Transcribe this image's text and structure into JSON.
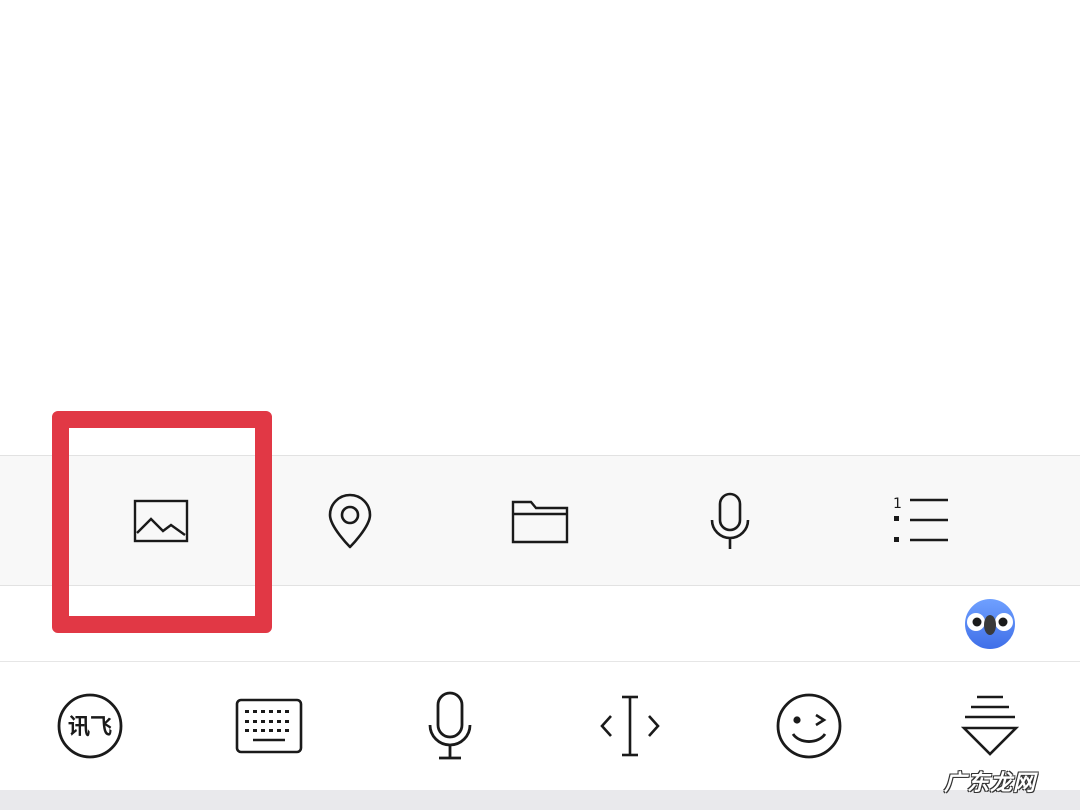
{
  "attach_toolbar": {
    "items": [
      {
        "icon": "image-icon",
        "label": "image"
      },
      {
        "icon": "location-pin-icon",
        "label": "location"
      },
      {
        "icon": "folder-icon",
        "label": "file"
      },
      {
        "icon": "microphone-icon",
        "label": "voice"
      },
      {
        "icon": "numbered-list-icon",
        "label": "list"
      }
    ],
    "list_marker": "1"
  },
  "suggestion_bar": {
    "assistant_icon": "bird-assistant-icon"
  },
  "keyboard_toolbar": {
    "logo_text": "讯飞",
    "items": [
      {
        "icon": "ifly-logo-icon"
      },
      {
        "icon": "keyboard-icon"
      },
      {
        "icon": "microphone-icon"
      },
      {
        "icon": "cursor-move-icon"
      },
      {
        "icon": "wink-emoji-icon"
      },
      {
        "icon": "collapse-keyboard-icon"
      }
    ]
  },
  "watermark": {
    "text": "广东龙网"
  },
  "annotation": {
    "highlight_color": "#e13845",
    "highlighted_item": "image-icon"
  },
  "colors": {
    "toolbar_bg": "#f8f8f8",
    "icon_stroke": "#1a1a1a",
    "bottom_strip": "#e9e9ec"
  }
}
